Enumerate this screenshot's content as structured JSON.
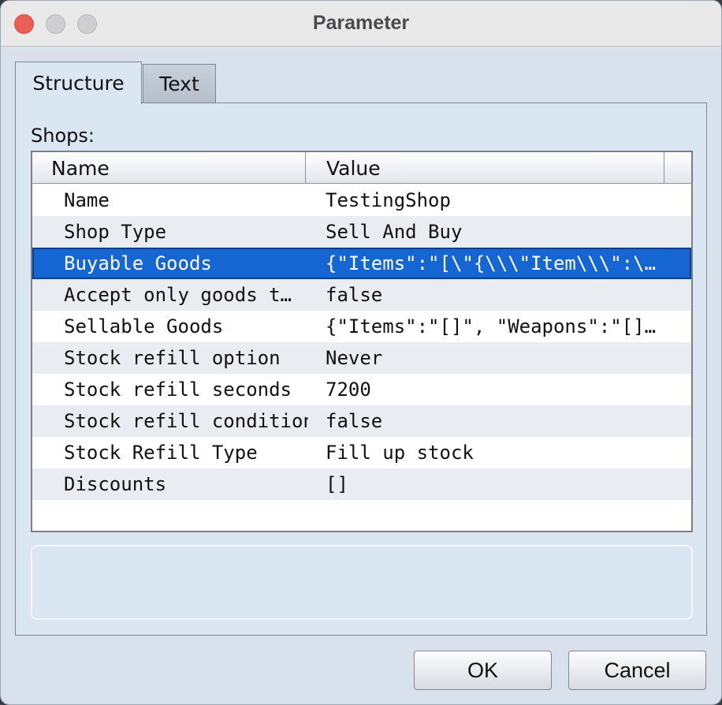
{
  "window": {
    "title": "Parameter"
  },
  "tabs": [
    {
      "label": "Structure",
      "active": true
    },
    {
      "label": "Text",
      "active": false
    }
  ],
  "shops_label": "Shops:",
  "table": {
    "columns": [
      "Name",
      "Value"
    ],
    "rows": [
      {
        "name": "Name",
        "value": "TestingShop"
      },
      {
        "name": "Shop Type",
        "value": "Sell And Buy"
      },
      {
        "name": "Buyable Goods",
        "value": "{\"Items\":\"[\\\"{\\\\\\\"Item\\\\\\\":\\…",
        "selected": true
      },
      {
        "name": "Accept only goods t…",
        "value": "false"
      },
      {
        "name": "Sellable Goods",
        "value": "{\"Items\":\"[]\", \"Weapons\":\"[]…"
      },
      {
        "name": "Stock refill option",
        "value": "Never"
      },
      {
        "name": "Stock refill seconds",
        "value": "7200"
      },
      {
        "name": "Stock refill condition",
        "value": "false"
      },
      {
        "name": "Stock Refill Type",
        "value": "Fill up stock"
      },
      {
        "name": "Discounts",
        "value": "[]"
      }
    ]
  },
  "buttons": {
    "ok": "OK",
    "cancel": "Cancel"
  },
  "colors": {
    "selection": "#1565d3",
    "panel": "#dbe6f3",
    "close_button": "#ec5f57"
  }
}
